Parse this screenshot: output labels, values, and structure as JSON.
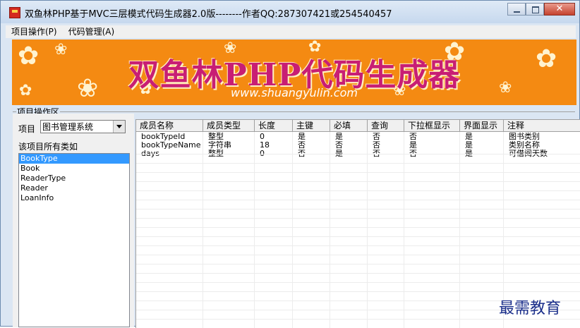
{
  "window": {
    "title": "双鱼林PHP基于MVC三层模式代码生成器2.0版--------作者QQ:287307421或254540457"
  },
  "menu": [
    "项目操作(P)",
    "代码管理(A)"
  ],
  "banner": {
    "title": "双鱼林PHP代码生成器",
    "url": "www.shuangyulin.com"
  },
  "group_label": "项目操作区",
  "project": {
    "label": "项目",
    "selected": "图书管理系统"
  },
  "class_list": {
    "label": "该项目所有类如",
    "items": [
      "BookType",
      "Book",
      "ReaderType",
      "Reader",
      "LoanInfo"
    ],
    "selected_index": 0
  },
  "grid": {
    "columns": [
      "成员名称",
      "成员类型",
      "长度",
      "主键",
      "必填",
      "查询",
      "下拉框显示",
      "界面显示",
      "注释"
    ],
    "rows": [
      [
        "bookTypeId",
        "整型",
        "0",
        "是",
        "是",
        "否",
        "否",
        "是",
        "图书类别"
      ],
      [
        "bookTypeName",
        "字符串",
        "18",
        "否",
        "否",
        "否",
        "是",
        "是",
        "类别名称"
      ],
      [
        "days",
        "整型",
        "0",
        "否",
        "是",
        "否",
        "否",
        "是",
        "可借阅天数"
      ]
    ]
  },
  "watermark": "最需教育"
}
